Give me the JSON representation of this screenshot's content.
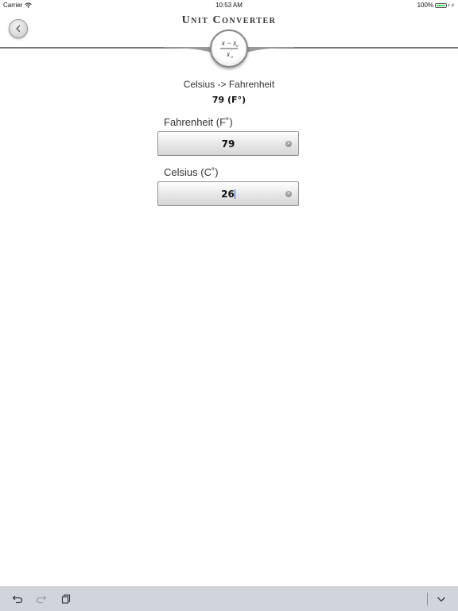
{
  "status_bar": {
    "carrier": "Carrier",
    "time": "10:53 AM",
    "battery": "100%",
    "battery_level": 100
  },
  "header": {
    "title": "Unit Converter",
    "back_icon": "chevron-left-icon",
    "logo_icon": "formula-logo-icon"
  },
  "conversion": {
    "title": "Celsius -> Fahrenheit",
    "result": "79 (F°)"
  },
  "fields": [
    {
      "label": "Fahrenheit (F˚)",
      "value": "79"
    },
    {
      "label": "Celsius (C˚)",
      "value": "26"
    }
  ],
  "toolbar": {
    "icons": [
      "undo-icon",
      "redo-icon",
      "paste-icon",
      "dismiss-keyboard-icon"
    ]
  },
  "colors": {
    "toolbar_bg": "#d1d4db",
    "battery": "#4cd964",
    "caret": "#1e64ff"
  }
}
